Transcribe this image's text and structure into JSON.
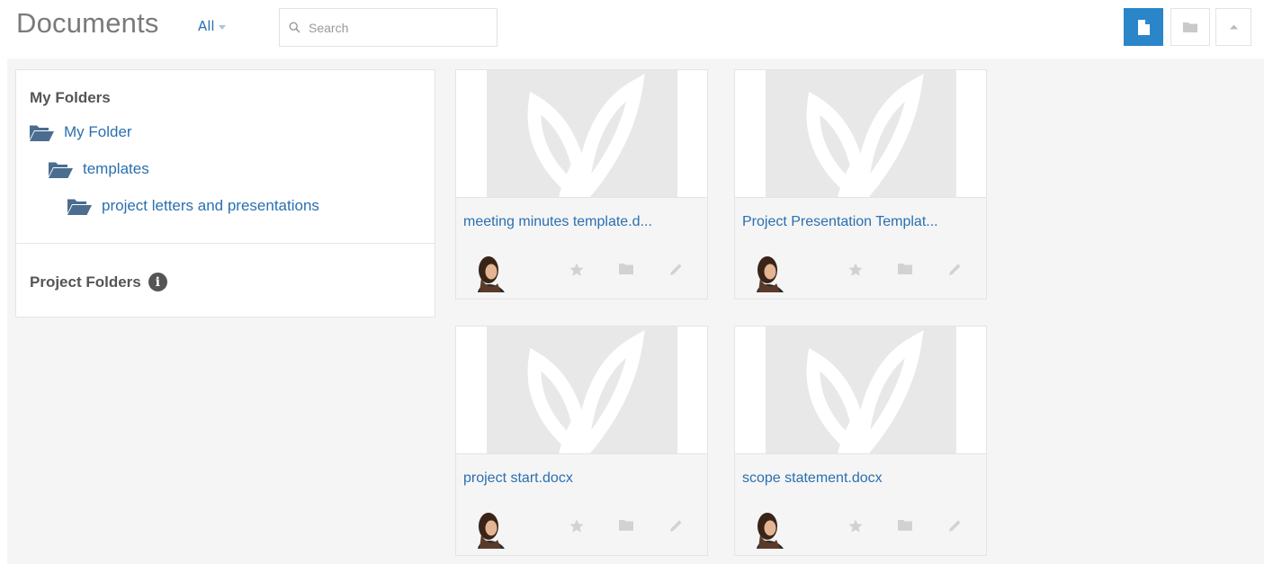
{
  "header": {
    "title": "Documents",
    "filter_label": "All",
    "search_placeholder": "Search"
  },
  "view_buttons": [
    {
      "icon": "document-icon",
      "active": true
    },
    {
      "icon": "folder-icon",
      "active": false
    },
    {
      "icon": "caret-up-icon",
      "active": false
    }
  ],
  "sidebar": {
    "my_folders_heading": "My Folders",
    "folders": [
      {
        "label": "My Folder",
        "depth": 0
      },
      {
        "label": "templates",
        "depth": 1
      },
      {
        "label": "project letters and presentations",
        "depth": 2
      }
    ],
    "project_folders_heading": "Project Folders"
  },
  "documents": [
    {
      "name": "meeting minutes template.d..."
    },
    {
      "name": "Project Presentation Templat..."
    },
    {
      "name": "project start.docx"
    },
    {
      "name": "scope statement.docx"
    }
  ],
  "colors": {
    "accent": "#2a85c9",
    "link": "#2a6fb0",
    "background": "#f5f5f5"
  }
}
